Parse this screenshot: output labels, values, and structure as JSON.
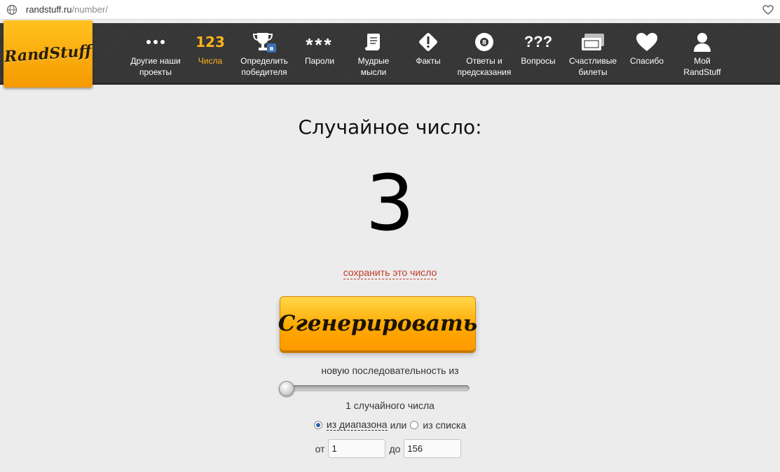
{
  "browser": {
    "url_host": "randstuff.ru",
    "url_path": "/number/"
  },
  "logo": {
    "text": "RandStuff"
  },
  "nav": {
    "items": [
      {
        "label": "Другие наши\nпроекты",
        "icon": "dots-icon"
      },
      {
        "label": "Числа",
        "icon": "numbers-123-icon",
        "icon_text": "123",
        "active": true
      },
      {
        "label": "Определить\nпобедителя",
        "icon": "trophy-icon",
        "badge": "в"
      },
      {
        "label": "Пароли",
        "icon": "asterisks-icon",
        "icon_text": "***"
      },
      {
        "label": "Мудрые\nмысли",
        "icon": "scroll-icon"
      },
      {
        "label": "Факты",
        "icon": "exclamation-diamond-icon"
      },
      {
        "label": "Ответы и\nпредсказания",
        "icon": "magic-8-ball-icon"
      },
      {
        "label": "Вопросы",
        "icon": "question-marks-icon",
        "icon_text": "???"
      },
      {
        "label": "Счастливые\nбилеты",
        "icon": "tickets-icon"
      },
      {
        "label": "Спасибо",
        "icon": "heart-icon"
      },
      {
        "label": "Мой\nRandStuff",
        "icon": "user-icon"
      }
    ]
  },
  "main": {
    "heading": "Случайное число:",
    "number": "3",
    "save_link": "сохранить это число",
    "generate_button": "Сгенерировать",
    "sequence_label": "новую последовательность из",
    "slider_level": 0,
    "count_label": "1 случайного числа",
    "mode_range": "из диапазона",
    "mode_or": "или",
    "mode_list": "из списка",
    "mode_selected": "range",
    "from_label": "от",
    "from_value": "1",
    "to_label": "до",
    "to_value": "156"
  },
  "colors": {
    "accent": "#ffb31a",
    "button": "#ffa800",
    "link": "#c0392b",
    "nav_bg": "#363636"
  }
}
